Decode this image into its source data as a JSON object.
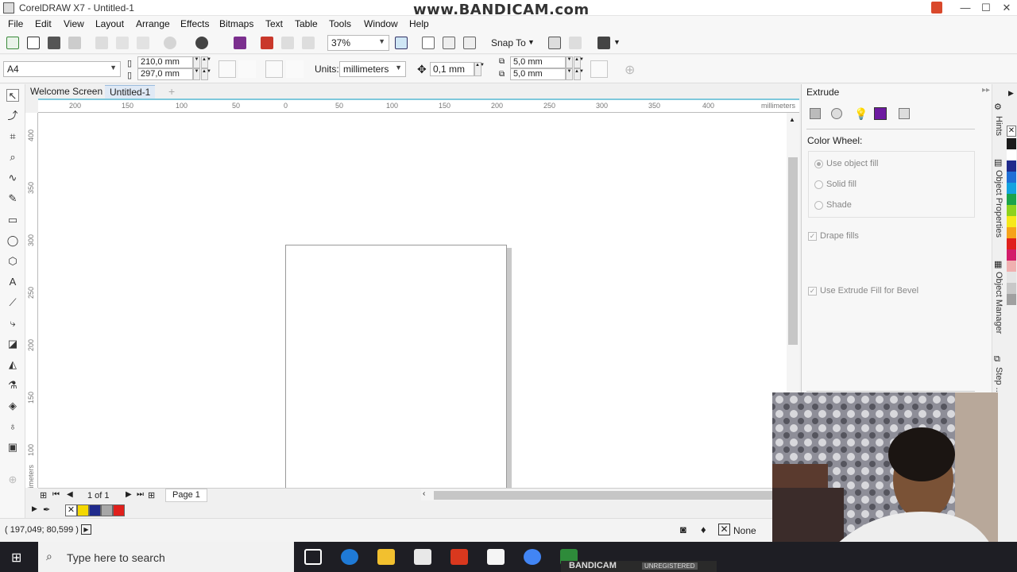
{
  "window": {
    "title": "CorelDRAW X7 - Untitled-1",
    "watermark": "www.BANDICAM.com",
    "controls": [
      "—",
      "☐",
      "✕"
    ]
  },
  "menu": [
    "File",
    "Edit",
    "View",
    "Layout",
    "Arrange",
    "Effects",
    "Bitmaps",
    "Text",
    "Table",
    "Tools",
    "Window",
    "Help"
  ],
  "toolbar": {
    "zoom": "37%",
    "snap_to": "Snap To"
  },
  "propbar": {
    "page_size": "A4",
    "width": "210,0 mm",
    "height": "297,0 mm",
    "units_label": "Units:",
    "units_value": "millimeters",
    "nudge": "0,1 mm",
    "dup_x": "5,0 mm",
    "dup_y": "5,0 mm"
  },
  "tabs": {
    "welcome": "Welcome Screen",
    "doc": "Untitled-1",
    "add": "+"
  },
  "ruler": {
    "h_labels": [
      "200",
      "150",
      "100",
      "50",
      "0",
      "50",
      "100",
      "150",
      "200",
      "250",
      "300",
      "350",
      "400"
    ],
    "h_unit": "millimeters",
    "v_labels": [
      "400",
      "350",
      "300",
      "250",
      "200",
      "150",
      "100"
    ],
    "v_unit": "millimeters"
  },
  "pagenav": {
    "count": "1 of 1",
    "page_tab": "Page 1"
  },
  "palette_colors": [
    "#f4d800",
    "#1f2a8c",
    "#a7a7a7",
    "#e0201c"
  ],
  "status": {
    "coords": "( 197,049; 80,599 )",
    "fill_none": "None"
  },
  "docker": {
    "title": "Extrude",
    "section": "Color Wheel:",
    "opt_object_fill": "Use object fill",
    "opt_solid_fill": "Solid fill",
    "opt_shade": "Shade",
    "drape_fills": "Drape fills",
    "use_extrude_fill": "Use Extrude Fill for Bevel"
  },
  "sidetabs": [
    "Hints",
    "Object Properties",
    "Object Manager",
    "Step ..."
  ],
  "right_palette": [
    "#1a1a1a",
    "#ffffff",
    "#1f2a8c",
    "#1e6fd6",
    "#13a3e0",
    "#1aa34a",
    "#8ed21e",
    "#f6e81a",
    "#f6a21a",
    "#e0201c",
    "#d31c6a",
    "#f0b0b0",
    "#e5e5e5",
    "#c8c8c8",
    "#a0a0a0"
  ],
  "taskbar": {
    "search_placeholder": "Type here to search",
    "bandicam": "BANDICAM",
    "unregistered": "UNREGISTERED"
  }
}
